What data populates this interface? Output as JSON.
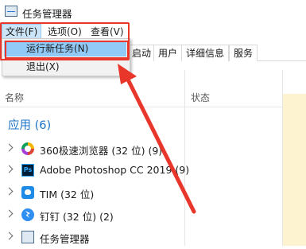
{
  "window": {
    "title": "任务管理器"
  },
  "menubar": {
    "file": "文件(F)",
    "options": "选项(O)",
    "view": "查看(V)"
  },
  "tabs": [
    "启动",
    "用户",
    "详细信息",
    "服务"
  ],
  "file_menu": {
    "items": [
      "运行新任务(N)",
      "退出(X)"
    ]
  },
  "columns": {
    "name": "名称",
    "status": "状态"
  },
  "group": {
    "label": "应用 (6)"
  },
  "rows": [
    {
      "label": "360极速浏览器 (32 位) (9)",
      "icon": "browser-360-icon"
    },
    {
      "label": "Adobe Photoshop CC 2019 (9)",
      "icon": "photoshop-icon"
    },
    {
      "label": "TIM (32 位)",
      "icon": "tim-icon"
    },
    {
      "label": "钉钉 (32 位) (2)",
      "icon": "dingtalk-icon"
    },
    {
      "label": "任务管理器",
      "icon": "task-manager-icon"
    }
  ],
  "colors": {
    "annotation": "#e8362b",
    "highlight": "#91c9f7",
    "group": "#1a72c9",
    "cpu_column": "#fdf3d0"
  }
}
